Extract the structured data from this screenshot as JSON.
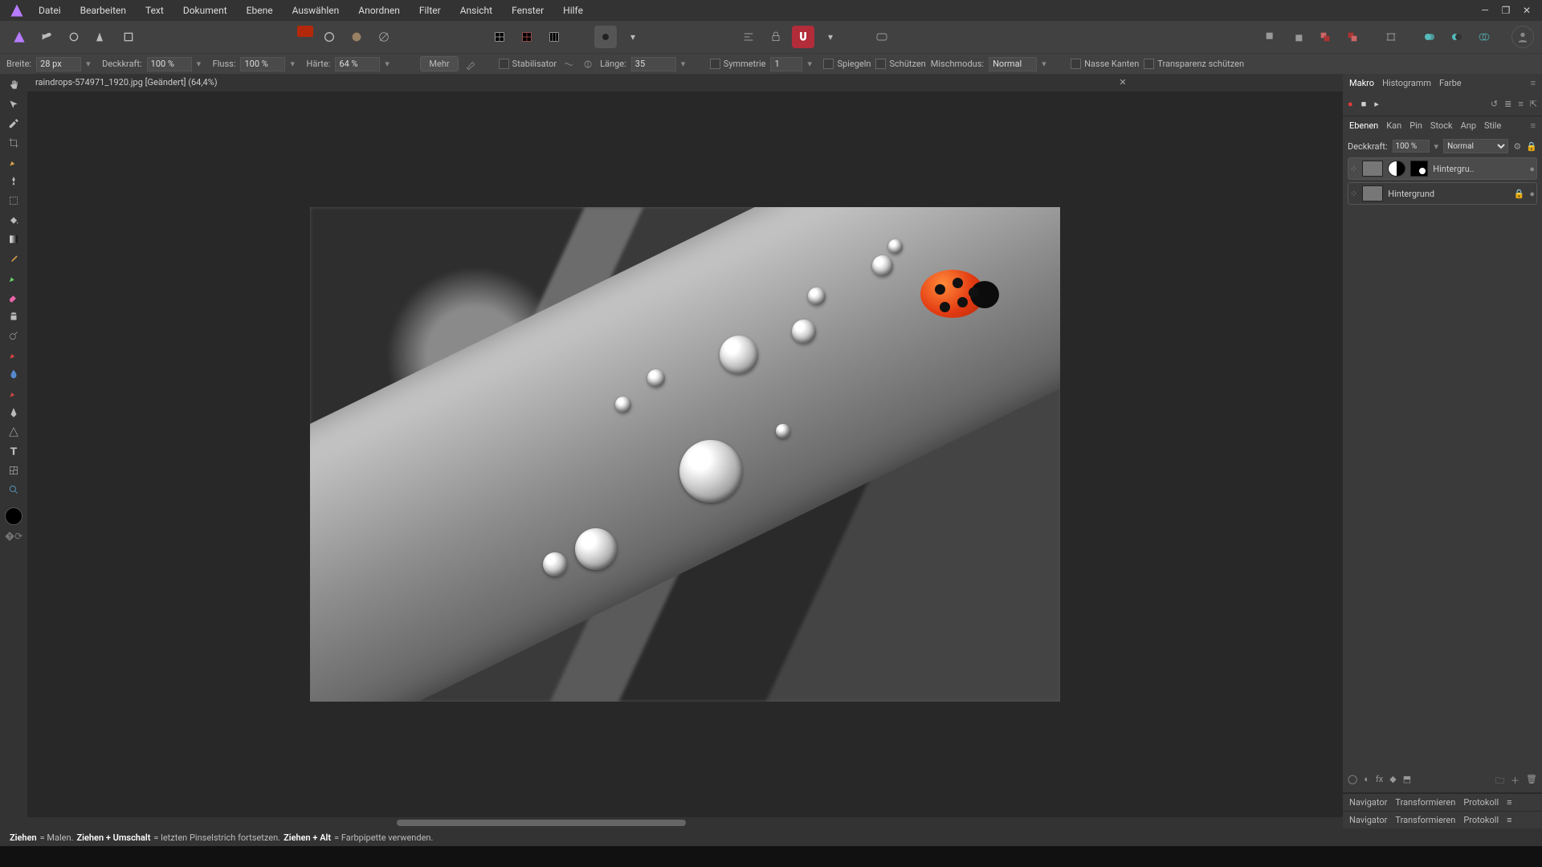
{
  "menu": [
    "Datei",
    "Bearbeiten",
    "Text",
    "Dokument",
    "Ebene",
    "Auswählen",
    "Anordnen",
    "Filter",
    "Ansicht",
    "Fenster",
    "Hilfe"
  ],
  "context": {
    "breite_label": "Breite:",
    "breite": "28 px",
    "deck_label": "Deckkraft:",
    "deck": "100 %",
    "fluss_label": "Fluss:",
    "fluss": "100 %",
    "haerte_label": "Härte:",
    "haerte": "64 %",
    "mehr": "Mehr",
    "stabil": "Stabilisator",
    "laenge_label": "Länge:",
    "laenge": "35",
    "symm": "Symmetrie",
    "symm_val": "1",
    "spiegeln": "Spiegeln",
    "schuetzen": "Schützen",
    "misch_label": "Mischmodus:",
    "misch": "Normal",
    "nasse": "Nasse Kanten",
    "transp": "Transparenz schützen"
  },
  "doc_tab": "raindrops-574971_1920.jpg [Geändert] (64,4%)",
  "right": {
    "macro_tabs": [
      "Makro",
      "Histogramm",
      "Farbe"
    ],
    "layer_tabs": [
      "Ebenen",
      "Kan",
      "Pin",
      "Stock",
      "Anp",
      "Stile"
    ],
    "opacity_label": "Deckkraft:",
    "opacity": "100 %",
    "blend": "Normal",
    "layers": [
      {
        "name": "Hintergru..",
        "adjust": true,
        "mask": true
      },
      {
        "name": "Hintergrund",
        "adjust": false,
        "mask": false,
        "locked": true
      }
    ],
    "nav_tabs": [
      "Navigator",
      "Transformieren",
      "Protokoll"
    ]
  },
  "hints": [
    {
      "b": "Ziehen",
      "t": " = Malen. "
    },
    {
      "b": "Ziehen + Umschalt",
      "t": " = letzten Pinselstrich fortsetzen. "
    },
    {
      "b": "Ziehen + Alt",
      "t": " = Farbpipette verwenden."
    }
  ],
  "drops": [
    {
      "l": 460,
      "t": 290,
      "s": 78
    },
    {
      "l": 510,
      "t": 160,
      "s": 48
    },
    {
      "l": 330,
      "t": 400,
      "s": 52
    },
    {
      "l": 290,
      "t": 430,
      "s": 30
    },
    {
      "l": 600,
      "t": 140,
      "s": 30
    },
    {
      "l": 620,
      "t": 100,
      "s": 22
    },
    {
      "l": 700,
      "t": 60,
      "s": 26
    },
    {
      "l": 720,
      "t": 40,
      "s": 18
    },
    {
      "l": 580,
      "t": 270,
      "s": 18
    },
    {
      "l": 420,
      "t": 202,
      "s": 22
    },
    {
      "l": 380,
      "t": 236,
      "s": 20
    }
  ]
}
